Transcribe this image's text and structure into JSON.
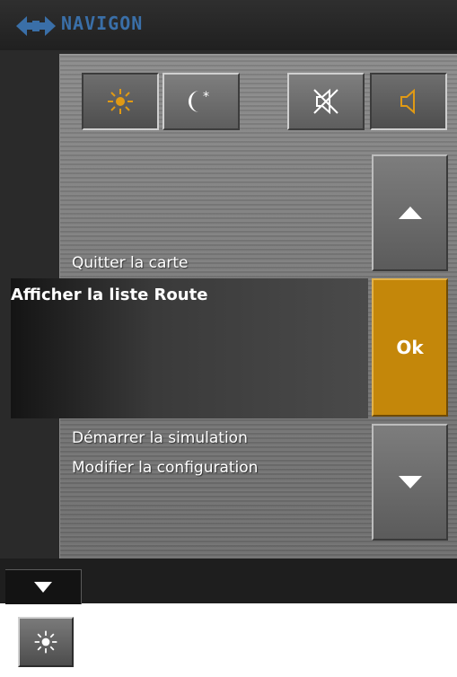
{
  "brand": {
    "name": "NAVIGON",
    "color": "#3a6fa8"
  },
  "toolbar": {
    "day_mode": {
      "icon": "sun-icon",
      "active": true
    },
    "night_mode": {
      "icon": "moon-star-icon",
      "active": false
    },
    "mute": {
      "icon": "speaker-muted-icon",
      "active": false
    },
    "sound": {
      "icon": "speaker-icon",
      "active": true
    }
  },
  "menu": {
    "items": [
      "Quitter la carte",
      "Afficher la liste Route",
      "Démarrer la simulation",
      "Modifier la configuration"
    ],
    "selected_index": 1
  },
  "controls": {
    "up_icon": "arrow-up-icon",
    "ok_label": "Ok",
    "down_icon": "arrow-down-icon",
    "accent": "#c4870a"
  },
  "bottom": {
    "collapse_icon": "chevron-down-icon",
    "extra_icon": "sun-icon"
  }
}
